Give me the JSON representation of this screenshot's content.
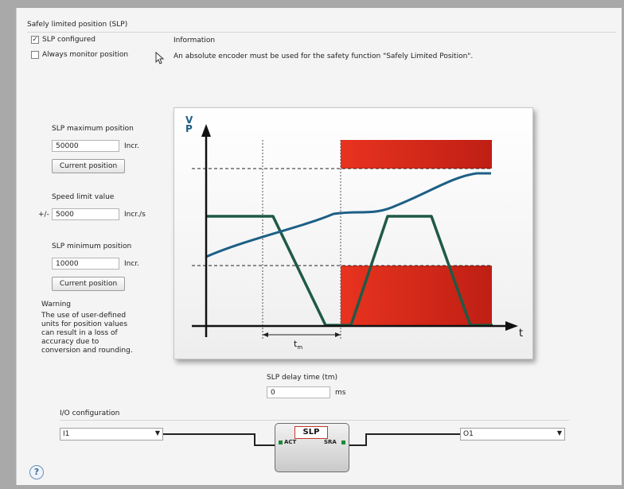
{
  "group": {
    "title": "Safely limited position (SLP)"
  },
  "options": {
    "slp_configured": {
      "label": "SLP configured",
      "checked": true,
      "mark": "✓"
    },
    "always_monitor": {
      "label": "Always monitor position",
      "checked": false
    }
  },
  "info": {
    "title": "Information",
    "text": "An absolute encoder must be used for the safety function \"Safely Limited Position\"."
  },
  "slp_max": {
    "label": "SLP maximum position",
    "value": "50000",
    "unit": "Incr.",
    "button": "Current position"
  },
  "speed_limit": {
    "label": "Speed limit value",
    "prefix": "+/-",
    "value": "5000",
    "unit": "Incr./s"
  },
  "slp_min": {
    "label": "SLP minimum position",
    "value": "10000",
    "unit": "Incr.",
    "button": "Current position"
  },
  "warning": {
    "title": "Warning",
    "lines": [
      "The use of user-defined",
      "units for position values",
      "can result in a loss of",
      "accuracy due to",
      "conversion and rounding."
    ]
  },
  "chart": {
    "y_label_v": "V",
    "y_label_p": "P",
    "x_label": "t",
    "tm_label": "t",
    "tm_sub": "m",
    "colors": {
      "red": "#d42a1c",
      "position_curve": "#1d5f86",
      "speed_curve": "#1f5a45"
    }
  },
  "delay": {
    "label": "SLP delay time (tm)",
    "value": "0",
    "unit": "ms"
  },
  "io": {
    "title": "I/O configuration",
    "input_select": "I1",
    "output_select": "O1",
    "block_label": "SLP",
    "act_label": "ACT",
    "sra_label": "SRA"
  },
  "help": {
    "glyph": "?"
  }
}
